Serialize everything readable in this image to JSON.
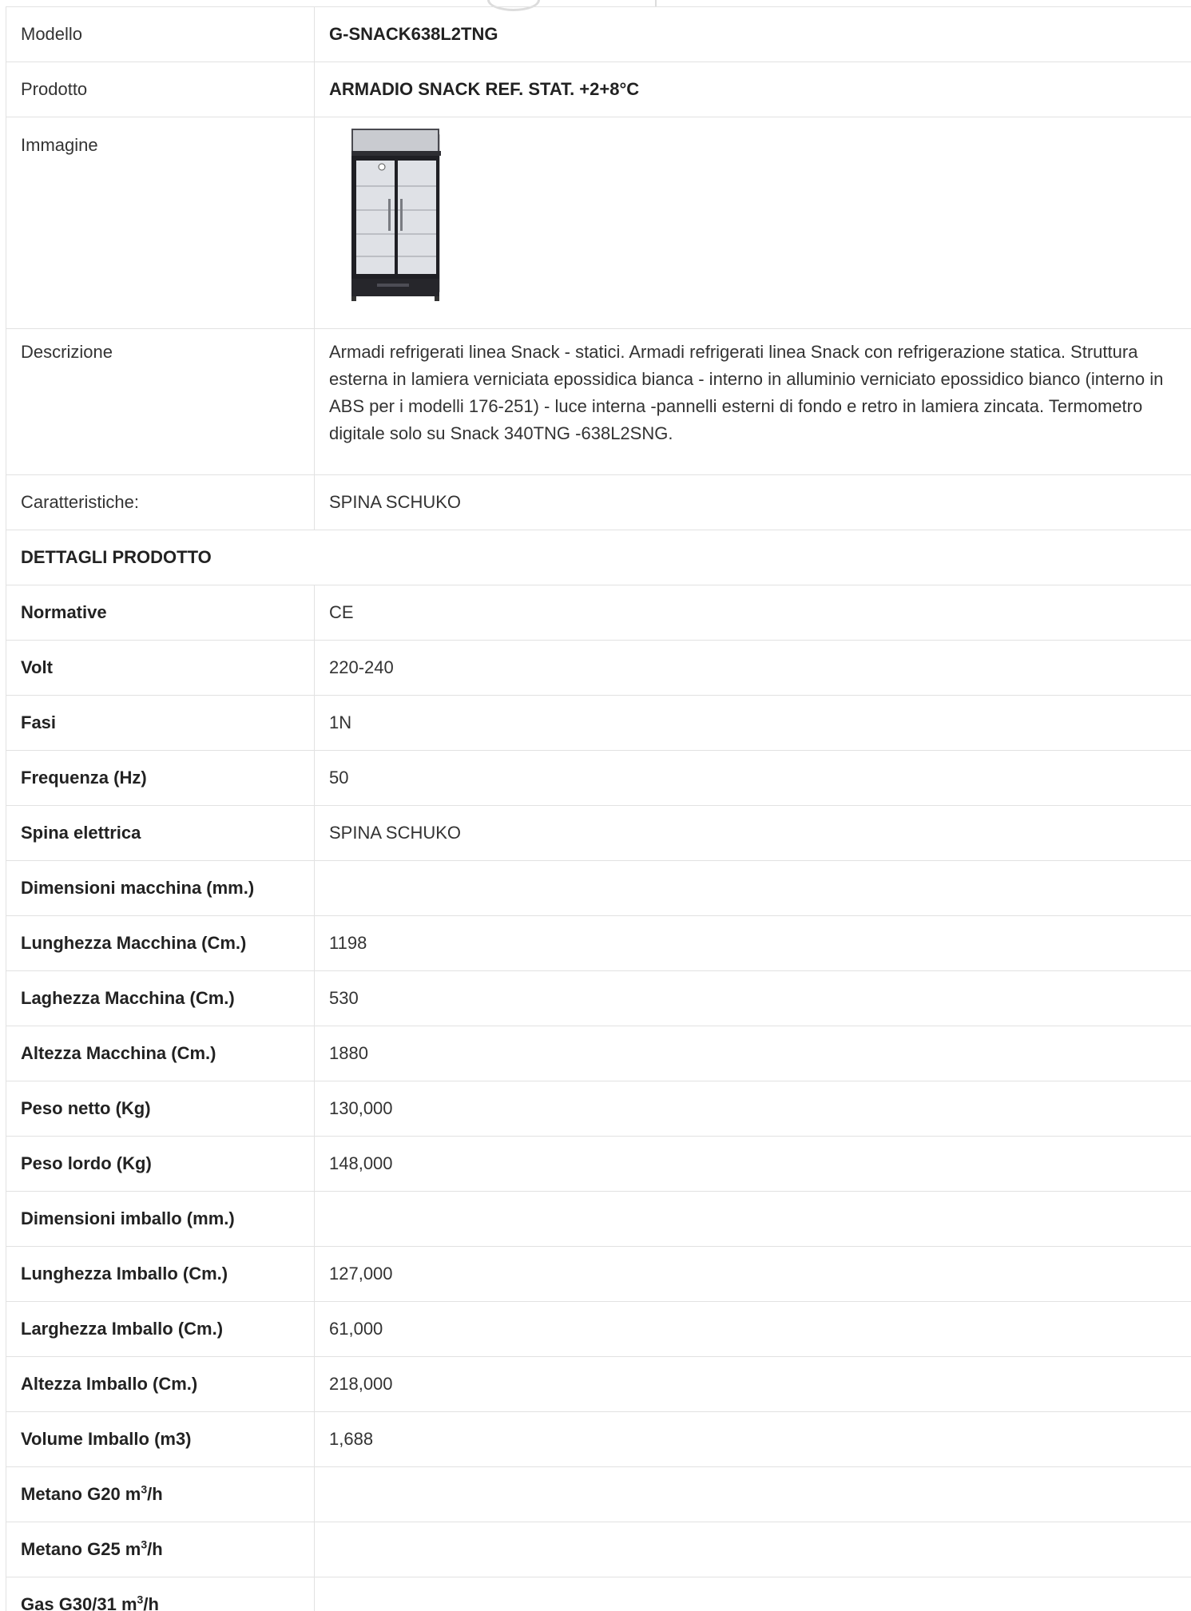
{
  "rows": [
    {
      "label": "Modello",
      "value": "G-SNACK638L2TNG"
    },
    {
      "label": "Prodotto",
      "value": "ARMADIO SNACK REF. STAT. +2+8°C"
    },
    {
      "label": "Immagine",
      "value": ""
    },
    {
      "label": "Descrizione",
      "value": "Armadi refrigerati linea Snack - statici. Armadi refrigerati linea Snack con refrigerazione statica. Struttura esterna in lamiera verniciata epossidica bianca - interno in alluminio verniciato epossidico bianco (interno in ABS per i modelli 176-251) - luce interna -pannelli esterni di fondo e retro in lamiera zincata. Termometro digitale solo su Snack 340TNG -638L2SNG."
    },
    {
      "label": "Caratteristiche:",
      "value": "SPINA SCHUKO"
    }
  ],
  "section_title": "DETTAGLI PRODOTTO",
  "details": [
    {
      "label": "Normative",
      "value": "CE"
    },
    {
      "label": "Volt",
      "value": "220-240"
    },
    {
      "label": "Fasi",
      "value": "1N"
    },
    {
      "label": "Frequenza (Hz)",
      "value": "50"
    },
    {
      "label": "Spina elettrica",
      "value": "SPINA SCHUKO"
    },
    {
      "label": "Dimensioni macchina (mm.)",
      "value": ""
    },
    {
      "label": "Lunghezza Macchina (Cm.)",
      "value": "1198"
    },
    {
      "label": "Laghezza Macchina (Cm.)",
      "value": "530"
    },
    {
      "label": "Altezza Macchina (Cm.)",
      "value": "1880"
    },
    {
      "label": "Peso netto (Kg)",
      "value": "130,000"
    },
    {
      "label": "Peso lordo (Kg)",
      "value": "148,000"
    },
    {
      "label": "Dimensioni imballo (mm.)",
      "value": ""
    },
    {
      "label": "Lunghezza Imballo (Cm.)",
      "value": "127,000"
    },
    {
      "label": "Larghezza Imballo (Cm.)",
      "value": "61,000"
    },
    {
      "label": "Altezza Imballo (Cm.)",
      "value": "218,000"
    },
    {
      "label": "Volume Imballo (m3)",
      "value": "1,688"
    }
  ],
  "gas_rows": [
    {
      "label_prefix": "Metano G20 m",
      "sup": "3",
      "label_suffix": "/h",
      "value": ""
    },
    {
      "label_prefix": "Metano G25 m",
      "sup": "3",
      "label_suffix": "/h",
      "value": ""
    },
    {
      "label_prefix": "Gas G30/31 m",
      "sup": "3",
      "label_suffix": "/h",
      "value": ""
    }
  ],
  "image_icon": "refrigerated-display-cabinet"
}
